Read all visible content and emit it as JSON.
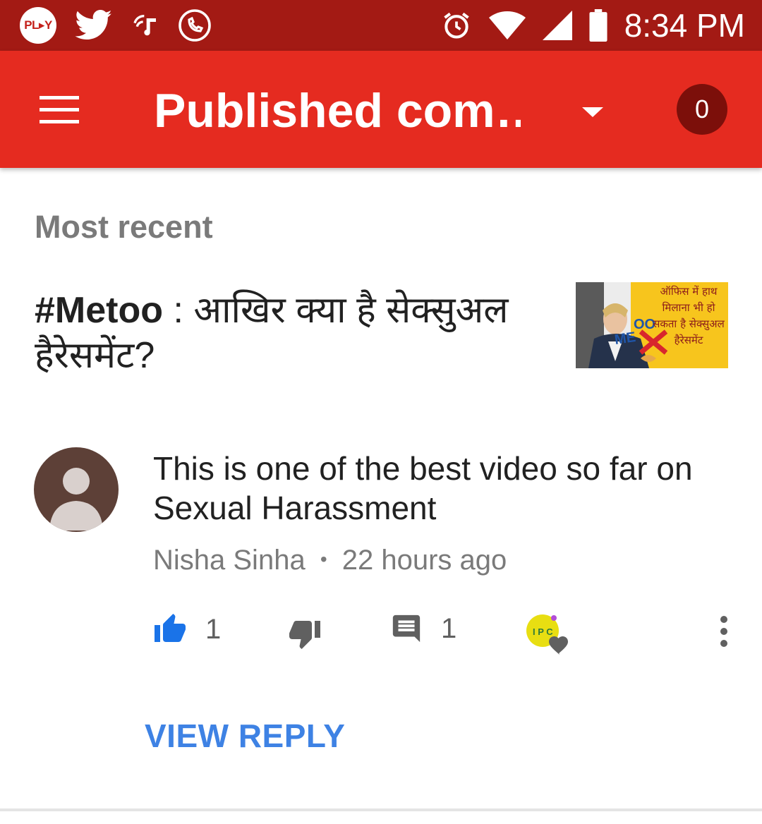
{
  "status_bar": {
    "play_badge": "PL▸Y",
    "time": "8:34 PM"
  },
  "app_bar": {
    "title": "Published com…",
    "notification_count": "0",
    "color": "#e52b20"
  },
  "section": {
    "sort_label": "Most recent"
  },
  "video": {
    "title_bold": "#Metoo",
    "title_rest": " : आखिर क्या है सेक्सुअल हैरेसमेंट?",
    "thumbnail_text": "ऑफिस में हाथ मिलाना भी हो सकता है सेक्सुअल हैरेसमेंट",
    "thumbnail_logo": "ME TOO"
  },
  "comment": {
    "text": "This is one of the best video so far on Sexual Harassment",
    "author": "Nisha Sinha",
    "separator": "•",
    "time": "22 hours ago",
    "like_count": "1",
    "reply_count": "1",
    "creator_avatar_text": "I P C"
  },
  "footer": {
    "view_reply_label": "VIEW REPLY"
  },
  "icons": {
    "status_left": [
      "play-badge",
      "twitter-icon",
      "music-cast-icon",
      "phone-call-icon"
    ],
    "status_right": [
      "alarm-icon",
      "wifi-icon",
      "signal-icon",
      "battery-icon"
    ],
    "actions": [
      "thumb-up-icon",
      "thumb-down-icon",
      "comment-icon",
      "creator-heart-icon",
      "more-vert-icon"
    ]
  },
  "colors": {
    "status_bar": "#a31a14",
    "like_active": "#1a73e8",
    "link": "#3e82e4"
  }
}
